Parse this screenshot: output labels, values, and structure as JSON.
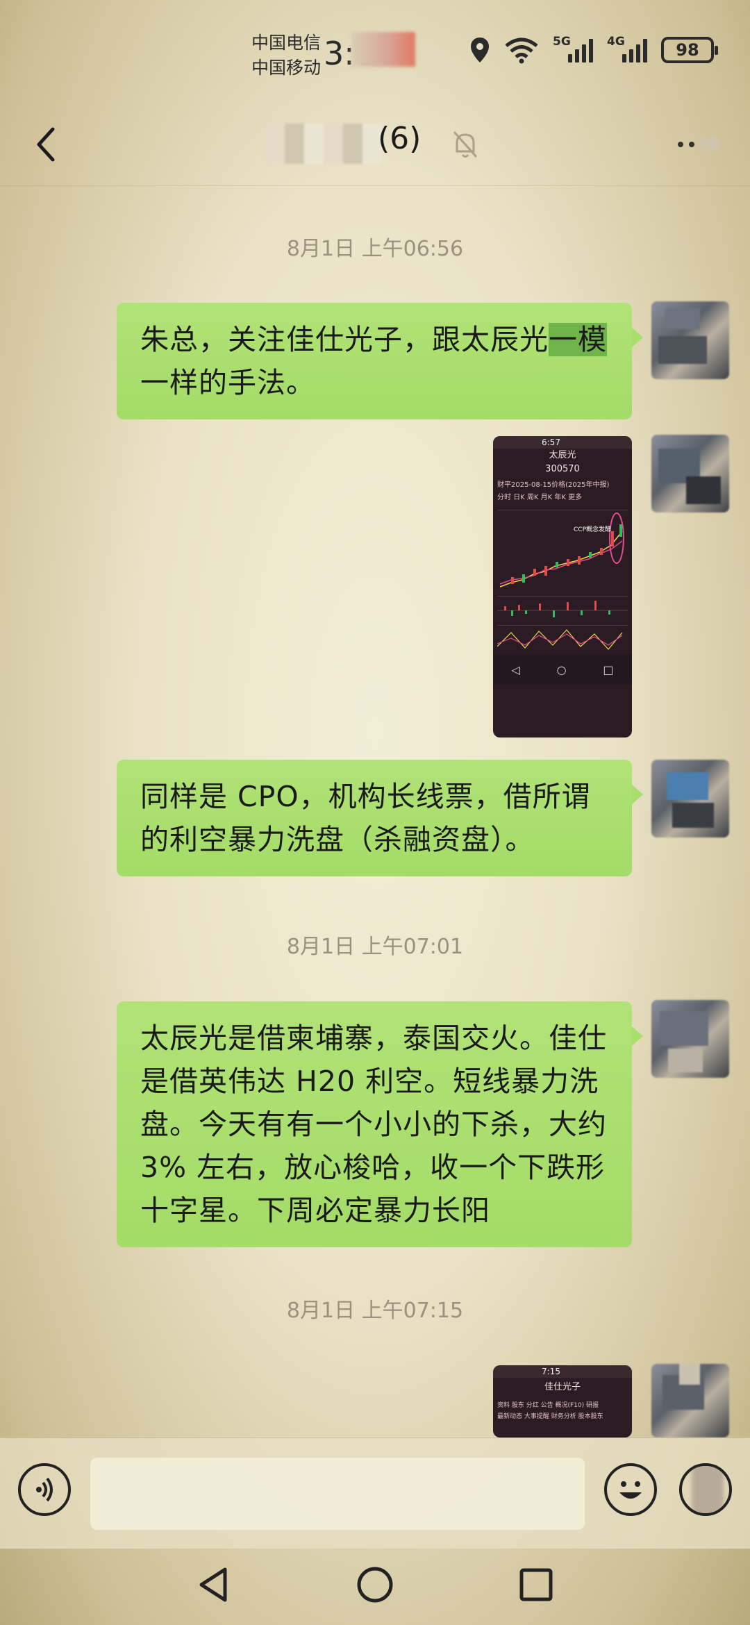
{
  "status_bar": {
    "carrier_1": "中国电信",
    "carrier_2": "中国移动",
    "time_visible": "3:0",
    "net_1": "5G",
    "net_2": "4G",
    "battery": "98",
    "icons": [
      "location-icon",
      "wifi-icon",
      "signal-5g-icon",
      "signal-4g-icon",
      "battery-icon"
    ]
  },
  "header": {
    "title_suffix": "(6)",
    "back_icon": "chevron-left-icon",
    "mute_icon": "bell-muted-icon",
    "more_icon": "more-dots-icon"
  },
  "messages": [
    {
      "type": "time",
      "text": "8月1日 上午06:56"
    },
    {
      "type": "text",
      "text_before": "朱总，关注佳仕光子，跟太辰光",
      "text_highlight": "一模",
      "text_after": "一样的手法。"
    },
    {
      "type": "image"
    },
    {
      "type": "text",
      "text": "同样是 CPO，机构长线票，借所谓的利空暴力洗盘（杀融资盘）。"
    },
    {
      "type": "time",
      "text": "8月1日 上午07:01"
    },
    {
      "type": "text",
      "text": "太辰光是借柬埔寨，泰国交火。佳仕是借英伟达 H20 利空。短线暴力洗盘。今天有有一个小小的下杀，大约 3% 左右，放心梭哈，收一个下跌形十字星。下周必定暴力长阳"
    },
    {
      "type": "time",
      "text": "8月1日 上午07:15"
    },
    {
      "type": "image"
    }
  ],
  "images": {
    "first": {
      "status": "6:57",
      "stock_name": "太辰光",
      "stock_code": "300570",
      "row_1": "财平2025-08-15价格(2025年中报)",
      "row_2": "分时  日K  周K  月K  年K  更多",
      "annotation": "CCP概念发酵"
    },
    "second": {
      "status": "7:15",
      "stock_name": "佳仕光子",
      "row_1": "资料  股东  分红  公告  概况(F10)  研报",
      "row_2": "最新动态  大事提醒  财务分析  股本股东"
    }
  },
  "input_bar": {
    "placeholder": "",
    "voice_icon": "voice-icon",
    "emoji_icon": "emoji-icon",
    "plus_icon": "plus-icon"
  },
  "nav_bar": {
    "icons": [
      "nav-back-icon",
      "nav-home-icon",
      "nav-recents-icon"
    ]
  }
}
